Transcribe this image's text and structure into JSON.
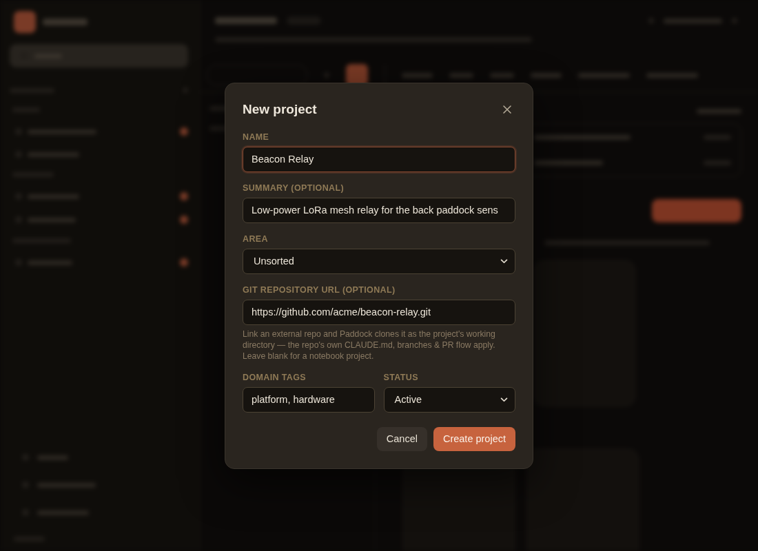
{
  "dialog": {
    "title": "New project",
    "fields": [
      {
        "kind": "text",
        "label": "NAME",
        "value": "Beacon Relay",
        "focused": true
      },
      {
        "kind": "text",
        "label": "SUMMARY (OPTIONAL)",
        "value": "Low-power LoRa mesh relay for the back paddock sens",
        "focused": false
      },
      {
        "kind": "select",
        "label": "AREA",
        "value": "Unsorted",
        "focused": false
      },
      {
        "kind": "text",
        "label": "GIT REPOSITORY URL (OPTIONAL)",
        "value": "https://github.com/acme/beacon-relay.git",
        "focused": false,
        "help": "Link an external repo and Paddock clones it as the project's working directory — the repo's own CLAUDE.md, branches & PR flow apply. Leave blank for a notebook project."
      }
    ],
    "row_fields": [
      {
        "kind": "text",
        "label": "DOMAIN TAGS",
        "value": "platform, hardware",
        "focused": false
      },
      {
        "kind": "select",
        "label": "STATUS",
        "value": "Active",
        "focused": false
      }
    ],
    "buttons": [
      {
        "kind": "secondary",
        "label": "Cancel"
      },
      {
        "kind": "primary",
        "label": "Create project"
      }
    ]
  }
}
